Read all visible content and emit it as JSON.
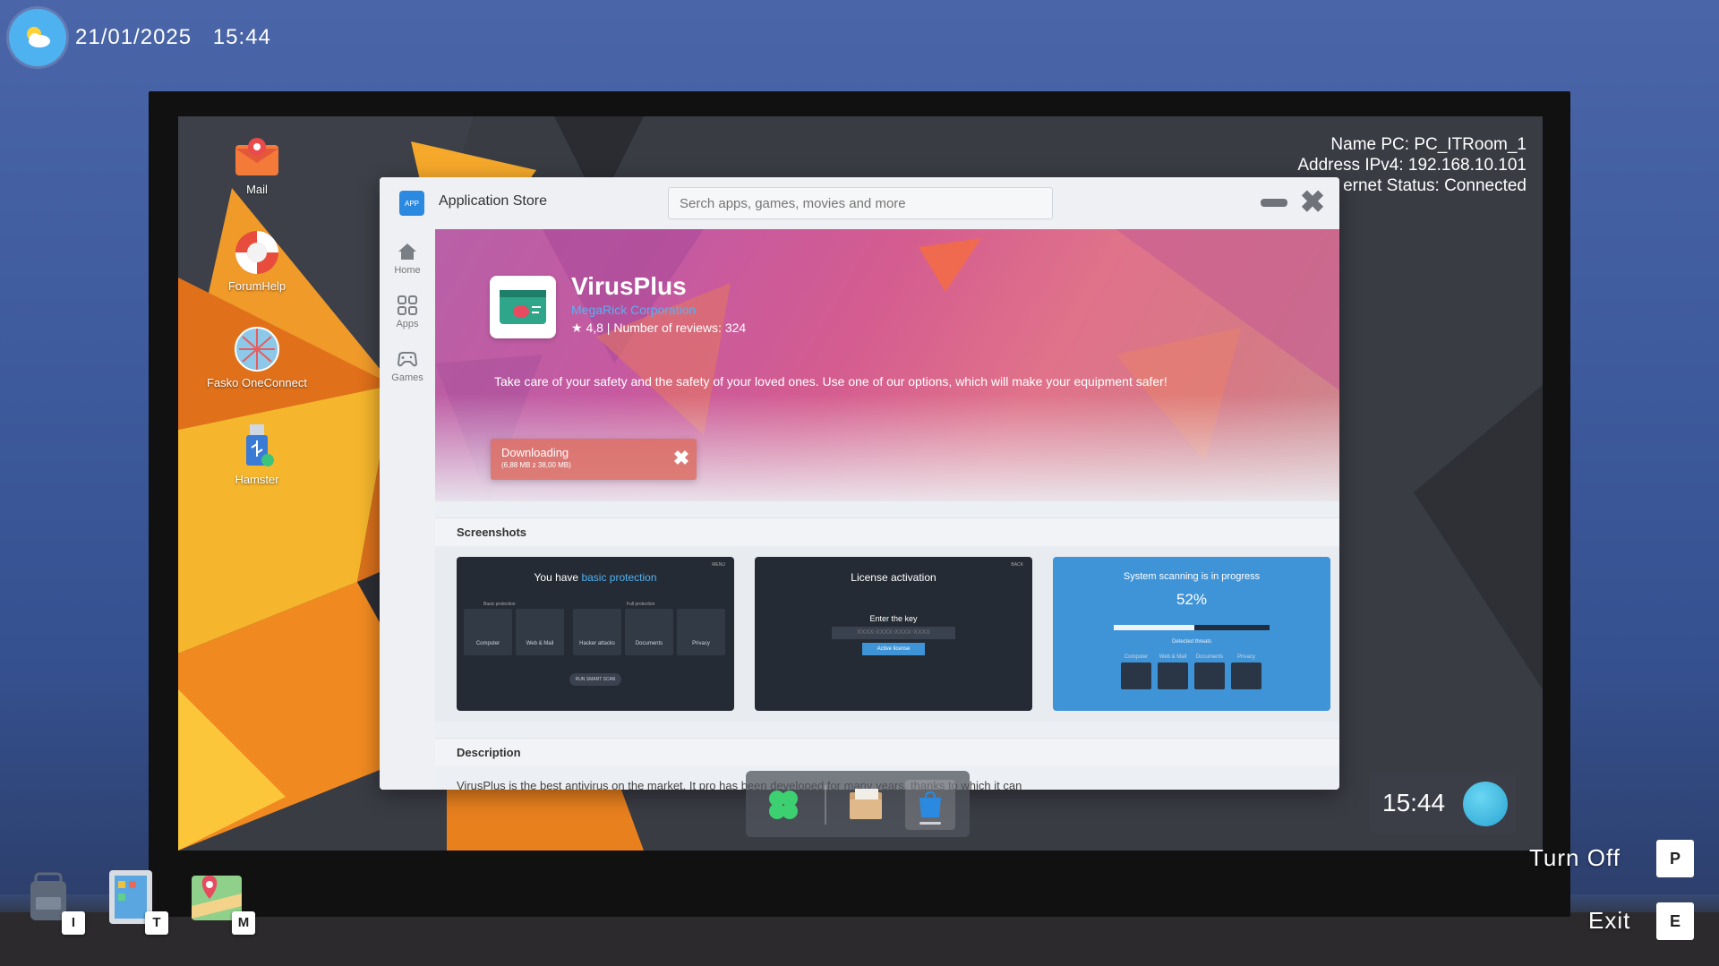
{
  "hud": {
    "date": "21/01/2025",
    "time": "15:44"
  },
  "desktop": {
    "icons": [
      {
        "label": "Mail"
      },
      {
        "label": "ForumHelp"
      },
      {
        "label": "Fasko OneConnect"
      },
      {
        "label": "Hamster"
      }
    ],
    "sysinfo": {
      "name_pc": "Name PC: PC_ITRoom_1",
      "address": "Address IPv4: 192.168.10.101",
      "internet": "ernet Status: Connected"
    },
    "clock": "15:44"
  },
  "window": {
    "title": "Application Store",
    "logo_text": "APP",
    "search_placeholder": "Serch apps, games, movies and more",
    "sidebar": [
      {
        "label": "Home",
        "icon": "home-icon"
      },
      {
        "label": "Apps",
        "icon": "apps-grid-icon"
      },
      {
        "label": "Games",
        "icon": "gamepad-icon"
      }
    ],
    "app": {
      "name": "VirusPlus",
      "developer": "MegaRick Corporation",
      "rating": "4,8 | Number of reviews: 324",
      "description": "Take care of your safety and the safety of your loved ones. Use one of our options, which will make your equipment safer!",
      "download_label": "Downloading",
      "download_size": "(6,88 MB z 38,00 MB)",
      "download_progress": 0.18
    },
    "screenshots_heading": "Screenshots",
    "screenshots": [
      {
        "title_prefix": "You have ",
        "title_accent": "basic protection",
        "corner": "MENU",
        "group_left": "Basic protection",
        "group_right": "Full protection",
        "cards": [
          "Computer",
          "Web & Mail",
          "Hacker attacks",
          "Documents",
          "Privacy"
        ],
        "button": "RUN SMART SCAN"
      },
      {
        "title": "License activation",
        "corner": "BACK",
        "key_label": "Enter the key",
        "key_placeholder": "XXXX-XXXX-XXXX-XXXX",
        "button": "Active license"
      },
      {
        "title": "System scanning is in progress",
        "percent": "52%",
        "progress": 0.52,
        "threats": "Detected threats",
        "cards": [
          "Computer",
          "Web & Mail",
          "Documents",
          "Privacy"
        ]
      }
    ],
    "description_heading": "Description",
    "description_text": "VirusPlus is the best antivirus on the market. It pro                                                  has been developed for many years, thanks to which it can"
  },
  "hud_tools": [
    {
      "key": "I",
      "icon": "backpack-icon"
    },
    {
      "key": "T",
      "icon": "tablet-icon"
    },
    {
      "key": "M",
      "icon": "map-icon"
    }
  ],
  "hud_actions": [
    {
      "label": "Turn Off",
      "key": "P"
    },
    {
      "label": "Exit",
      "key": "E"
    }
  ],
  "colors": {
    "accent": "#2b8ae0",
    "developer_link": "#5bb0f0",
    "scan_blue": "#3f94d8"
  }
}
